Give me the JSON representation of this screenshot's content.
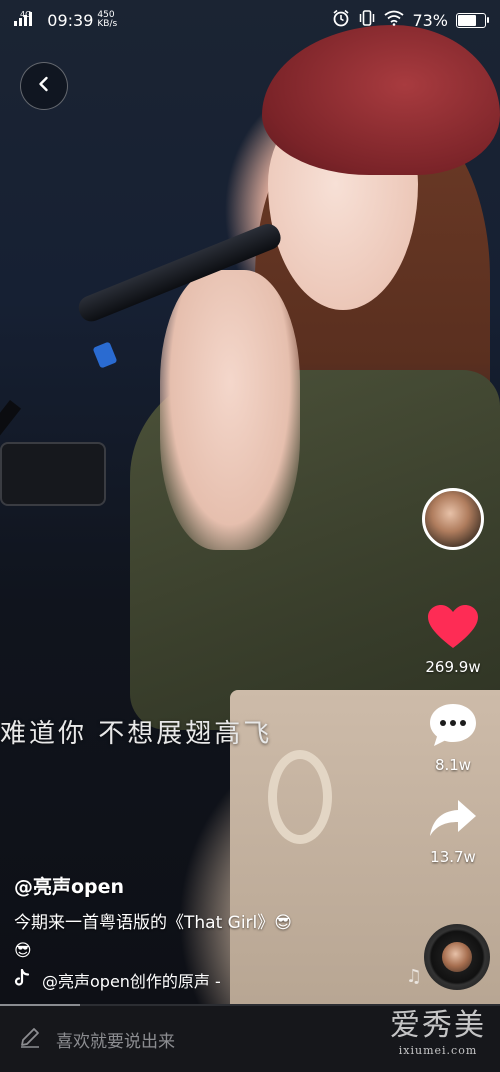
{
  "status_bar": {
    "signal": "4G",
    "time": "09:39",
    "net_speed_value": "450",
    "net_speed_unit": "KB/s",
    "battery_percent": "73%",
    "battery_level": 0.73
  },
  "video": {
    "lyric": "难道你 不想展翅高飞",
    "progress": 0.16
  },
  "side_actions": {
    "like_count": "269.9w",
    "comment_count": "8.1w",
    "share_count": "13.7w",
    "like_color": "#fe2c55"
  },
  "post": {
    "author": "@亮声open",
    "description_line1": "今期来一首粤语版的《That Girl》😎",
    "description_line2": "😎",
    "music": "@亮声open创作的原声 -"
  },
  "comment_bar": {
    "placeholder": "喜欢就要说出来"
  },
  "watermark": {
    "main": "爱秀美",
    "sub": "ixiumei.com"
  }
}
